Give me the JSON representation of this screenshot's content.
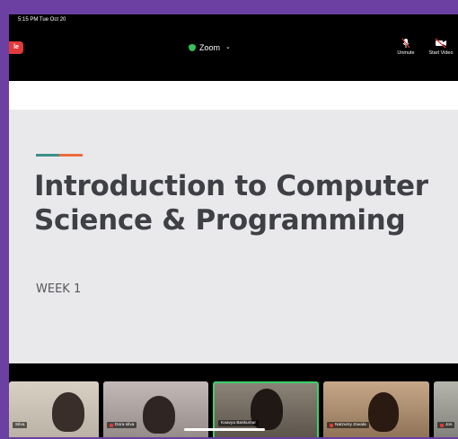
{
  "status_bar": {
    "time": "5:15 PM  Tue Oct 20"
  },
  "toolbar": {
    "end_label": "le",
    "meeting_title": "Zoom",
    "unmute_label": "Unmute",
    "start_video_label": "Start Video"
  },
  "slide": {
    "title_line1": "Introduction to Computer",
    "title_line2": "Science & Programming",
    "subtitle": "WEEK 1",
    "accent_colors": [
      "#3f8f8b",
      "#ec6b3a"
    ]
  },
  "participants": [
    {
      "name": "Silva"
    },
    {
      "name": "Dora silva"
    },
    {
      "name": "Kaavya Baskumar"
    },
    {
      "name": "Natzumy Zavala"
    },
    {
      "name": "Jos"
    }
  ],
  "colors": {
    "frame": "#6c3fa3",
    "end_button": "#e03a3a",
    "secure_green": "#35c15a",
    "active_speaker": "#3ecf6a"
  }
}
